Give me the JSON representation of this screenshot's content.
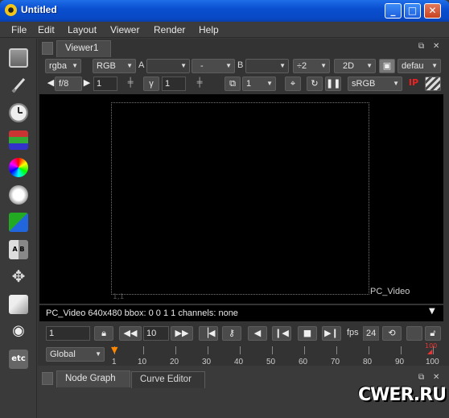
{
  "window": {
    "title": "Untitled"
  },
  "menu": [
    "File",
    "Edit",
    "Layout",
    "Viewer",
    "Render",
    "Help"
  ],
  "toolbar_icons": [
    "image-icon",
    "brush-icon",
    "clock-icon",
    "channel-icon",
    "color-wheel-icon",
    "filter-icon",
    "keyer-icon",
    "merge-icon",
    "transform-icon",
    "3d-icon",
    "view-icon",
    "other-icon"
  ],
  "toolbar_other_label": "etc",
  "viewer": {
    "tab": "Viewer1",
    "channels": "rgba",
    "channel_set": "RGB",
    "input_a_label": "A",
    "input_a_op": "-",
    "input_b_label": "B",
    "downscale": "÷2",
    "view_mode": "2D",
    "lut_default": "defau",
    "fstop": "f/8",
    "gain": "1",
    "gamma_label": "γ",
    "gamma": "1",
    "proxy": "1",
    "colorspace": "sRGB",
    "ip_label": "IP",
    "corner_origin": "1,1",
    "format_name": "PC_Video",
    "info": "PC_Video 640x480 bbox: 0 0 1 1 channels: none"
  },
  "playback": {
    "frame": "1",
    "increment": "10",
    "fps_label": "fps",
    "fps": "24",
    "range_mode": "Global",
    "timeline_ticks": [
      "1",
      "10",
      "20",
      "30",
      "40",
      "50",
      "60",
      "70",
      "80",
      "90",
      "100"
    ],
    "out_marker": "100"
  },
  "bottom_tabs": [
    "Node Graph",
    "Curve Editor"
  ],
  "watermark": "CWER.RU"
}
